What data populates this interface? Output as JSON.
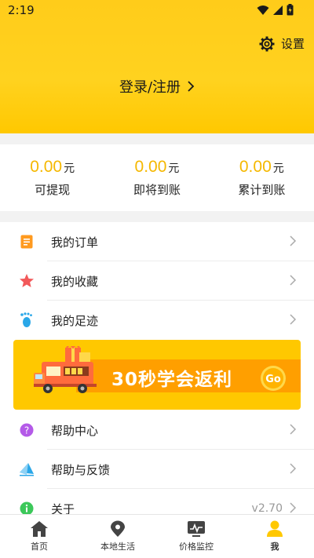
{
  "status_bar": {
    "time": "2:19"
  },
  "header": {
    "settings_label": "设置",
    "login_label": "登录/注册"
  },
  "earnings": [
    {
      "amount": "0.00",
      "unit": "元",
      "label": "可提现"
    },
    {
      "amount": "0.00",
      "unit": "元",
      "label": "即将到账"
    },
    {
      "amount": "0.00",
      "unit": "元",
      "label": "累计到账"
    }
  ],
  "menu": {
    "orders": {
      "label": "我的订单",
      "icon": "order-icon"
    },
    "favorites": {
      "label": "我的收藏",
      "icon": "star-icon"
    },
    "history": {
      "label": "我的足迹",
      "icon": "footprint-icon"
    },
    "help_center": {
      "label": "帮助中心",
      "icon": "question-icon"
    },
    "feedback": {
      "label": "帮助与反馈",
      "icon": "paper-plane-icon"
    },
    "about": {
      "label": "关于",
      "icon": "info-icon",
      "version": "v2.70"
    }
  },
  "banner": {
    "text": "30秒学会返利",
    "button": "Go"
  },
  "tabbar": [
    {
      "label": "首页",
      "icon": "home-icon"
    },
    {
      "label": "本地生活",
      "icon": "location-pin-icon"
    },
    {
      "label": "价格监控",
      "icon": "monitor-chart-icon"
    },
    {
      "label": "我",
      "icon": "person-icon",
      "active": true
    }
  ],
  "colors": {
    "brand_yellow": "#ffc800",
    "amount_yellow": "#f5b800",
    "banner_orange": "#ff9f00"
  }
}
